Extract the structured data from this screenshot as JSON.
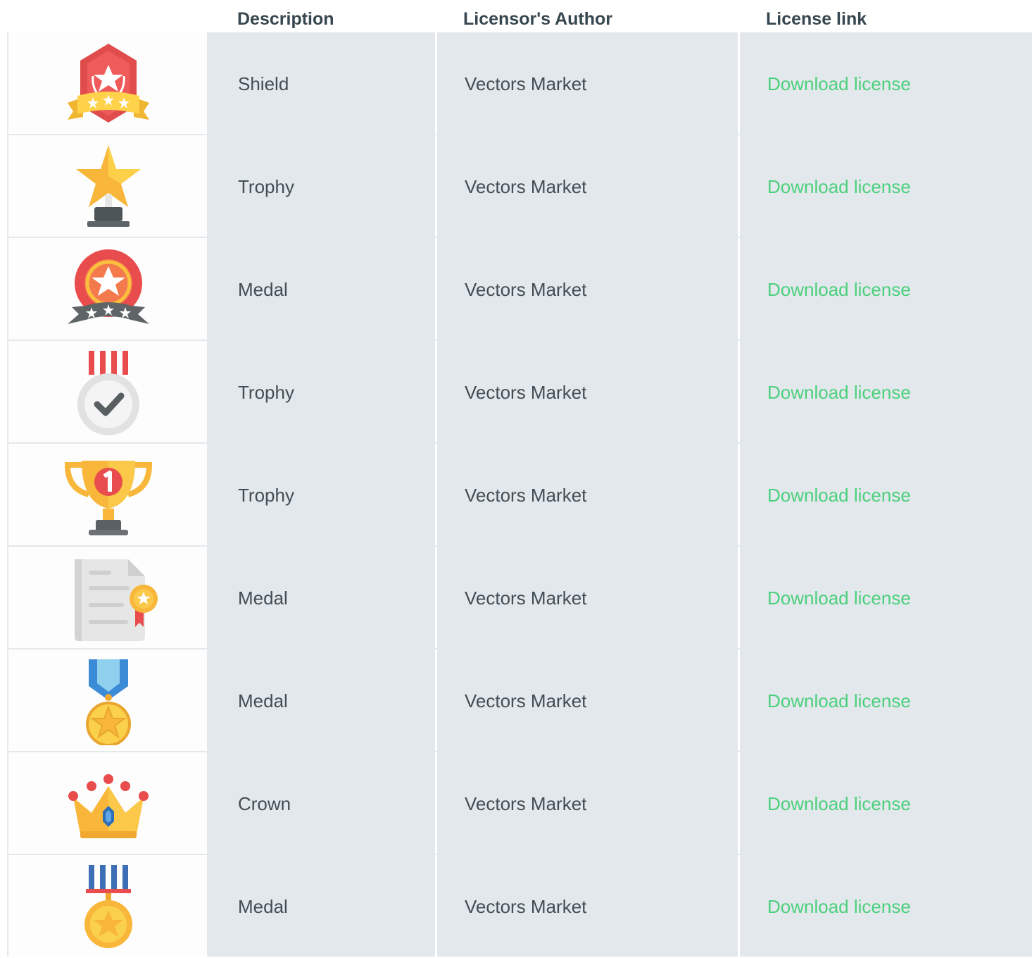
{
  "table": {
    "headers": {
      "description": "Description",
      "author": "Licensor's Author",
      "link": "License link"
    },
    "rows": [
      {
        "icon": "shield-badge-icon",
        "description": "Shield",
        "author": "Vectors Market",
        "link": "Download license"
      },
      {
        "icon": "star-trophy-icon",
        "description": "Trophy",
        "author": "Vectors Market",
        "link": "Download license"
      },
      {
        "icon": "rosette-medal-icon",
        "description": "Medal",
        "author": "Vectors Market",
        "link": "Download license"
      },
      {
        "icon": "check-medal-icon",
        "description": "Trophy",
        "author": "Vectors Market",
        "link": "Download license"
      },
      {
        "icon": "cup-trophy-icon",
        "description": "Trophy",
        "author": "Vectors Market",
        "link": "Download license"
      },
      {
        "icon": "certificate-icon",
        "description": "Medal",
        "author": "Vectors Market",
        "link": "Download license"
      },
      {
        "icon": "star-medal-blue-icon",
        "description": "Medal",
        "author": "Vectors Market",
        "link": "Download license"
      },
      {
        "icon": "crown-icon",
        "description": "Crown",
        "author": "Vectors Market",
        "link": "Download license"
      },
      {
        "icon": "gold-medal-icon",
        "description": "Medal",
        "author": "Vectors Market",
        "link": "Download license"
      }
    ]
  },
  "colors": {
    "link": "#4cd07d",
    "cell_bg": "#e3e8ec",
    "header_text": "#37474f"
  }
}
